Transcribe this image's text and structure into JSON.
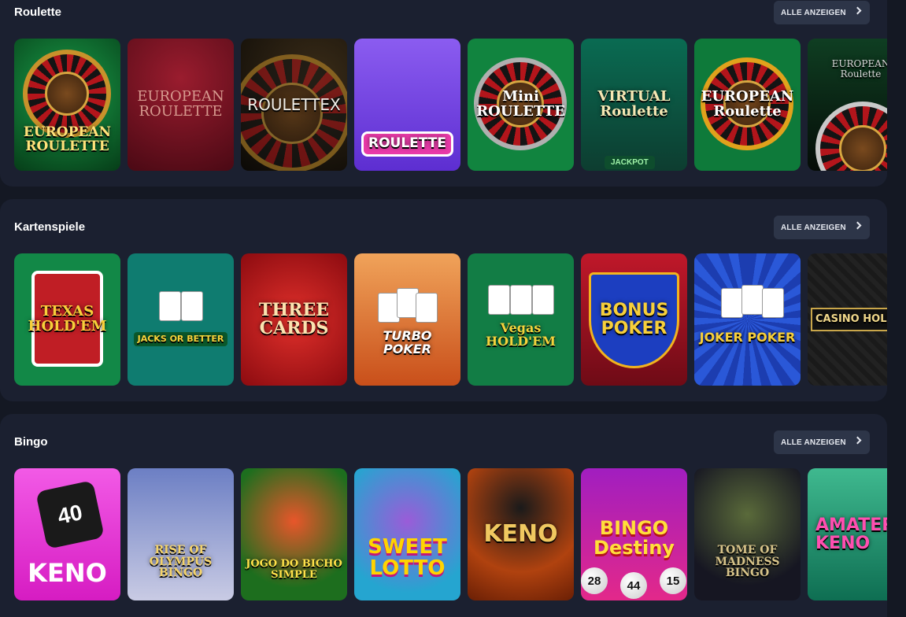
{
  "sections": [
    {
      "title": "Roulette",
      "button": "ALLE ANZEIGEN",
      "tiles": [
        {
          "name": "EUROPEAN ROULETTE",
          "bg": "#0d6b2c"
        },
        {
          "name": "EUROPEAN ROULETTE",
          "bg": "#6e1020"
        },
        {
          "name": "ROULETTEX",
          "bg": "#17130f"
        },
        {
          "name": "ROULETTE",
          "bg": "#7a4fe0"
        },
        {
          "name": "Mini ROULETTE",
          "bg": "#11843f"
        },
        {
          "name": "VIRTUAL Roulette",
          "bg": "#0f5a46",
          "badge": "JACKPOT"
        },
        {
          "name": "EUROPEAN Roulette",
          "bg": "#0e7a3a"
        },
        {
          "name": "EUROPEAN Roulette",
          "bg": "#0b2c18"
        }
      ]
    },
    {
      "title": "Kartenspiele",
      "button": "ALLE ANZEIGEN",
      "tiles": [
        {
          "name": "TEXAS HOLD'EM",
          "bg": "#128847"
        },
        {
          "name": "JACKS OR BETTER",
          "bg": "#0f7c70"
        },
        {
          "name": "THREE CARDS",
          "bg": "#c41d21"
        },
        {
          "name": "TURBO POKER",
          "bg": "#d85b1f"
        },
        {
          "name": "Vegas HOLD'EM",
          "bg": "#127d45"
        },
        {
          "name": "BONUS POKER",
          "bg": "#a01220"
        },
        {
          "name": "JOKER POKER",
          "bg": "#1f3fb2"
        },
        {
          "name": "CASINO HOLD'",
          "bg": "#1f1f1f"
        }
      ]
    },
    {
      "title": "Bingo",
      "button": "ALLE ANZEIGEN",
      "tiles": [
        {
          "name": "KENO",
          "bg": "#ee2ad8",
          "extra": "40"
        },
        {
          "name": "RISE OF OLYMPUS BINGO",
          "bg": "#8fa4d6"
        },
        {
          "name": "JOGO DO BICHO SIMPLE",
          "bg": "#2f8b26"
        },
        {
          "name": "SWEET LOTTO",
          "bg": "#2fb8d6"
        },
        {
          "name": "KENO",
          "bg": "#a3360c"
        },
        {
          "name": "BINGO Destiny",
          "bg": "#b81f8a",
          "balls": [
            "28",
            "44",
            "15"
          ]
        },
        {
          "name": "TOME OF MADNESS BINGO",
          "bg": "#2b2b40"
        },
        {
          "name": "AMATERA KENO",
          "bg": "#1b8c6b"
        }
      ]
    }
  ],
  "colors": {
    "page_bg": "#141823",
    "section_bg": "#1b2030",
    "button_bg": "#2d3548"
  }
}
